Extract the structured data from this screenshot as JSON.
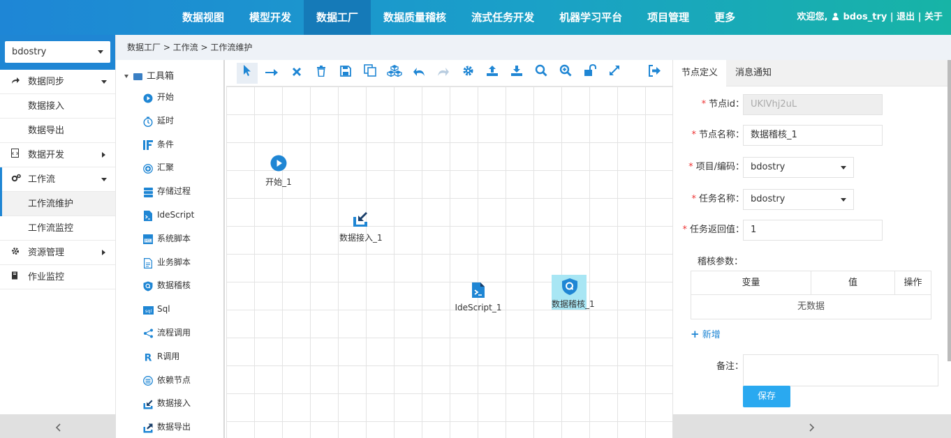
{
  "nav": {
    "items": [
      "数据视图",
      "模型开发",
      "数据工厂",
      "数据质量稽核",
      "流式任务开发",
      "机器学习平台",
      "项目管理",
      "更多"
    ],
    "active_index": 2
  },
  "user": {
    "welcome": "欢迎您,",
    "name": "bdos_try",
    "logout": "退出",
    "about": "关于",
    "sep": "|"
  },
  "sidebar": {
    "project": "bdostry",
    "items": [
      {
        "label": "数据同步",
        "icon": "share-icon"
      },
      {
        "label": "数据接入"
      },
      {
        "label": "数据导出"
      },
      {
        "label": "数据开发",
        "icon": "code-file-icon"
      },
      {
        "label": "工作流",
        "icon": "gears-icon"
      },
      {
        "label": "工作流维护"
      },
      {
        "label": "工作流监控"
      },
      {
        "label": "资源管理",
        "icon": "gear-icon"
      },
      {
        "label": "作业监控",
        "icon": "book-icon"
      }
    ]
  },
  "breadcrumb": {
    "text": "数据工厂 > 工作流 > 工作流维护"
  },
  "toolbox": {
    "title": "工具箱",
    "items": [
      {
        "label": "开始",
        "icon": "play-icon"
      },
      {
        "label": "延时",
        "icon": "timer-icon"
      },
      {
        "label": "条件",
        "icon": "if-icon",
        "glyph": "IF"
      },
      {
        "label": "汇聚",
        "icon": "merge-icon"
      },
      {
        "label": "存储过程",
        "icon": "database-icon"
      },
      {
        "label": "IdeScript",
        "icon": "terminal-icon"
      },
      {
        "label": "系统脚本",
        "icon": "shell-icon"
      },
      {
        "label": "业务脚本",
        "icon": "script-icon"
      },
      {
        "label": "数据稽核",
        "icon": "shield-q-icon",
        "glyph": "Q"
      },
      {
        "label": "Sql",
        "icon": "sql-icon",
        "glyph": "sql"
      },
      {
        "label": "流程调用",
        "icon": "flow-call-icon"
      },
      {
        "label": "R调用",
        "icon": "r-icon",
        "glyph": "R"
      },
      {
        "label": "依赖节点",
        "icon": "dependency-icon"
      },
      {
        "label": "数据接入",
        "icon": "import-icon"
      },
      {
        "label": "数据导出",
        "icon": "export-icon"
      }
    ]
  },
  "canvas": {
    "toolbar": [
      "pointer-icon",
      "connector-arrow-icon",
      "delete-x-icon",
      "trash-icon",
      "save-icon",
      "copy-icon",
      "cubes-icon",
      "undo-icon",
      "redo-icon",
      "settings-icon",
      "upload-icon",
      "download-icon",
      "search-icon",
      "zoom-in-icon",
      "unlock-icon",
      "fullscreen-icon",
      "exit-icon"
    ],
    "nodes": [
      {
        "label": "开始_1",
        "icon": "play-icon"
      },
      {
        "label": "数据接入_1",
        "icon": "import-icon"
      },
      {
        "label": "IdeScript_1",
        "icon": "terminal-icon"
      },
      {
        "label": "数据稽核_1",
        "icon": "shield-q-icon",
        "glyph": "Q",
        "selected": true
      }
    ]
  },
  "panel": {
    "tabs": [
      "节点定义",
      "消息通知"
    ],
    "fields": {
      "node_id": {
        "label": "节点id：",
        "value": "UKlVhj2uL"
      },
      "node_name": {
        "label": "节点名称：",
        "value": "数据稽核_1"
      },
      "project": {
        "label": "项目/编码：",
        "value": "bdostry"
      },
      "task": {
        "label": "任务名称：",
        "value": "bdostry"
      },
      "ret": {
        "label": "任务返回值：",
        "value": "1"
      }
    },
    "params_label": "稽核参数：",
    "table_headers": [
      "变量",
      "值",
      "操作"
    ],
    "empty_text": "无数据",
    "add_label": "新增",
    "remark_label": "备注：",
    "save_label": "保存"
  },
  "colors": {
    "primary": "#1f86d4",
    "save": "#2aa9f0"
  }
}
